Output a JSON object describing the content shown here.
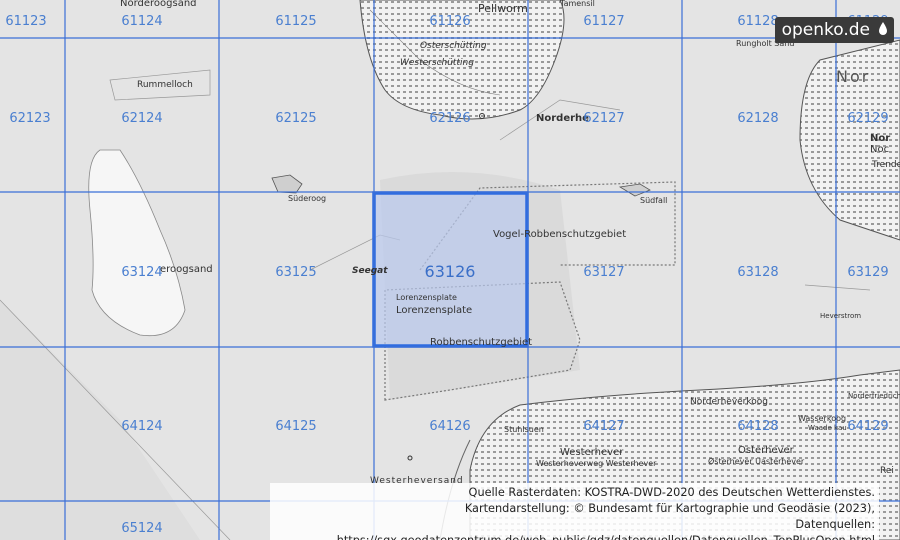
{
  "brand": {
    "name": "openko.de",
    "color": "#3a3a3a"
  },
  "colors": {
    "grid": "#3a6fd8",
    "selected_fill": "#b9c9ee",
    "selected_stroke": "#2f6ce0",
    "land": "#f4f4f4",
    "water": "#e6e6e6"
  },
  "selected_cell": "63126",
  "grid_labels": {
    "row0": [
      "61123",
      "61124",
      "61125",
      "61126",
      "61127",
      "61128",
      "61129"
    ],
    "row1": [
      "62123",
      "62124",
      "62125",
      "62126",
      "62127",
      "62128",
      "62129"
    ],
    "row2": [
      "63124",
      "63125",
      "63126",
      "63127",
      "63128",
      "63129"
    ],
    "row3": [
      "64124",
      "64125",
      "64126",
      "64127",
      "64128",
      "64129"
    ],
    "row4": [
      "65124"
    ]
  },
  "places": {
    "pellworm": "Pellworm",
    "tamensil": "Tamensil",
    "norderoogsand": "Norderoogsand",
    "osterschuetting": "Osterschütting",
    "westerschuetting": "Westerschütting",
    "rungholt": "Rungholt Sand",
    "rummelloch": "Rummelloch",
    "norderhe": "Norderhe",
    "suederoog": "Süderoog",
    "suedfall": "Südfall",
    "vogel": "Vogel-Robbenschutzgebiet",
    "seegat": "Seegat",
    "eroogsand": "eroogsand",
    "lorenzensplate1": "Lorenzensplate",
    "lorenzensplate2": "Lorenzensplate",
    "robben": "Robbenschutzgebiet",
    "heverstrom": "Heverstrom",
    "stuhlsuen": "Stuhlsuen",
    "westerhever": "Westerhever",
    "westerheverweg": "Westerheverweg Westerhever",
    "westerheversand": "Westerheversand",
    "norderheverkoog": "Norderheverkoog",
    "osterhever": "Osterhever",
    "osterheverlaster": "Østerhever Uasterhever",
    "wasserkoog": "Wasserkoog",
    "waadekau": "Waade kau",
    "norderfriedrich": "Norderfriedrich",
    "nor": "Nor",
    "nord1": "Nor",
    "nord2": "Noc",
    "trende": "Trende",
    "reu": "Rei"
  },
  "credits": {
    "line1": "Quelle Rasterdaten: KOSTRA-DWD-2020 des Deutschen Wetterdienstes.",
    "line2": "Kartendarstellung: © Bundesamt für Kartographie und Geodäsie (2023),",
    "line3": "Datenquellen: https://sgx.geodatenzentrum.de/web_public/gdz/datenquellen/Datenquellen_TopPlusOpen.html"
  }
}
